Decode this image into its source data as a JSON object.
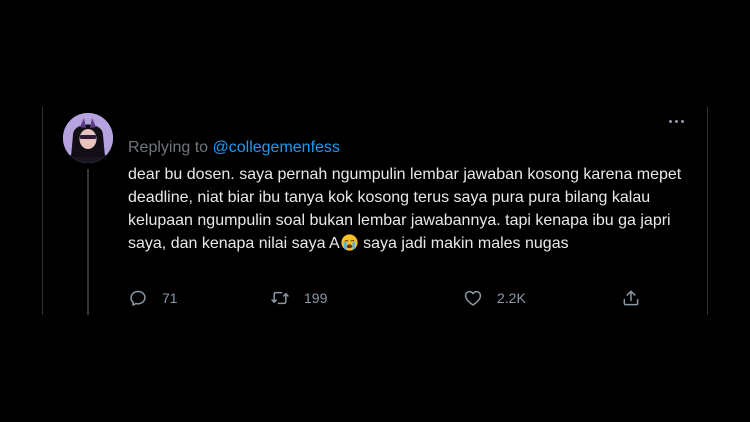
{
  "reply": {
    "prefix": "Replying to",
    "handle": "@collegemenfess"
  },
  "tweet": {
    "text_part1": "dear bu dosen. saya pernah ngumpulin lembar jawaban kosong karena mepet deadline, niat biar ibu tanya kok kosong terus saya pura pura bilang kalau kelupaan ngumpulin soal bukan lembar jawabannya. tapi kenapa ibu ga japri saya, dan kenapa nilai saya A",
    "emoji": "crying-face",
    "text_part2": " saya jadi makin males nugas"
  },
  "actions": {
    "replies": "71",
    "retweets": "199",
    "likes": "2.2K"
  },
  "icons": [
    "more-icon",
    "reply-icon",
    "retweet-icon",
    "like-icon",
    "share-icon"
  ],
  "colors": {
    "background": "#000000",
    "text": "#e7e9ea",
    "muted": "#71767b",
    "link": "#1d9bf0",
    "divider": "#2f3336"
  }
}
